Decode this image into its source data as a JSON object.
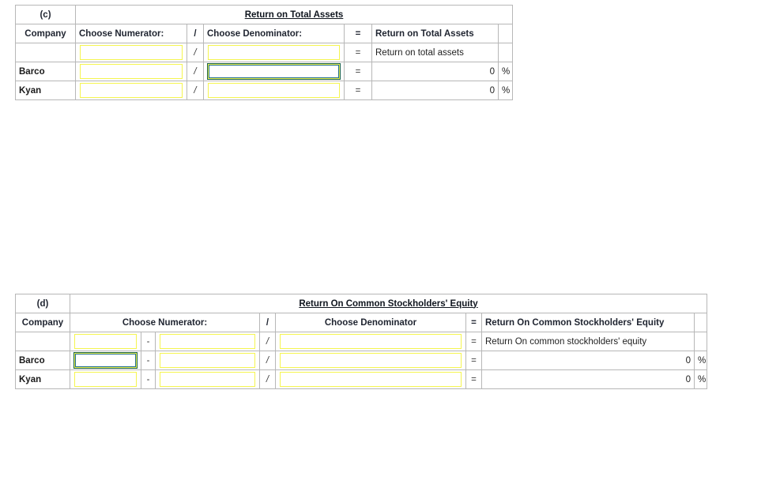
{
  "page": {
    "background": "#ffffff",
    "header_fill": "#8ca6da",
    "input_border": "#f5f54f",
    "selected_border": "#16604a",
    "grid_border": "#b7b7b7"
  },
  "tables": [
    {
      "id": "table-c",
      "part_label": "(c)",
      "title": "Return on Total Assets",
      "columns": [
        "Company",
        "Choose Numerator:",
        "/",
        "Choose Denominator:",
        "=",
        "Return on Total Assets",
        ""
      ],
      "rows": [
        {
          "company": "",
          "numerator": "",
          "divider": "/",
          "denominator": "",
          "equals": "=",
          "result": "Return on total assets",
          "result_align": "left",
          "percent": "",
          "selected": ""
        },
        {
          "company": "Barco",
          "numerator": "",
          "divider": "/",
          "denominator": "",
          "equals": "=",
          "result": "0",
          "result_align": "right",
          "percent": "%",
          "selected": "denominator"
        },
        {
          "company": "Kyan",
          "numerator": "",
          "divider": "/",
          "denominator": "",
          "equals": "=",
          "result": "0",
          "result_align": "right",
          "percent": "%",
          "selected": ""
        }
      ]
    },
    {
      "id": "table-d",
      "part_label": "(d)",
      "title": "Return On Common Stockholders' Equity",
      "columns": [
        "Company",
        "Choose Numerator:",
        "/",
        "Choose Denominator",
        "=",
        "Return On Common Stockholders' Equity",
        ""
      ],
      "rows": [
        {
          "company": "",
          "numerator_a": "",
          "minus": "-",
          "numerator_b": "",
          "divider": "/",
          "denominator": "",
          "equals": "=",
          "result": "Return On common stockholders' equity",
          "result_align": "left",
          "percent": "",
          "selected": ""
        },
        {
          "company": "Barco",
          "numerator_a": "",
          "minus": "-",
          "numerator_b": "",
          "divider": "/",
          "denominator": "",
          "equals": "=",
          "result": "0",
          "result_align": "right",
          "percent": "%",
          "selected": "numerator_a"
        },
        {
          "company": "Kyan",
          "numerator_a": "",
          "minus": "-",
          "numerator_b": "",
          "divider": "/",
          "denominator": "",
          "equals": "=",
          "result": "0",
          "result_align": "right",
          "percent": "%",
          "selected": ""
        }
      ]
    }
  ]
}
